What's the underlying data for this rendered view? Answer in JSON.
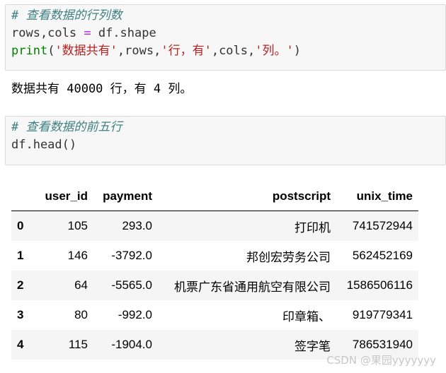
{
  "cell1": {
    "comment": "# 查看数据的行列数",
    "line2_vars": "rows,cols ",
    "line2_op": "=",
    "line2_rest": " df.shape",
    "line3_print": "print",
    "line3_open": "(",
    "line3_str1": "'数据共有'",
    "line3_mid1": ",rows,",
    "line3_str2": "'行，有'",
    "line3_mid2": ",cols,",
    "line3_str3": "'列。'",
    "line3_close": ")"
  },
  "output1": "数据共有 40000 行，有 4 列。",
  "cell2": {
    "comment": "# 查看数据的前五行",
    "code": "df.head()"
  },
  "table": {
    "columns": [
      "",
      "user_id",
      "payment",
      "postscript",
      "unix_time"
    ],
    "rows": [
      {
        "index": "0",
        "user_id": "105",
        "payment": "293.0",
        "postscript": "打印机",
        "unix_time": "741572944"
      },
      {
        "index": "1",
        "user_id": "146",
        "payment": "-3792.0",
        "postscript": "邦创宏劳务公司",
        "unix_time": "562452169"
      },
      {
        "index": "2",
        "user_id": "64",
        "payment": "-5565.0",
        "postscript": "机票广东省通用航空有限公司",
        "unix_time": "1586506116"
      },
      {
        "index": "3",
        "user_id": "80",
        "payment": "-992.0",
        "postscript": "印章箱、",
        "unix_time": "919779341"
      },
      {
        "index": "4",
        "user_id": "115",
        "payment": "-1904.0",
        "postscript": "签字笔",
        "unix_time": "786531940"
      }
    ]
  },
  "watermark": "CSDN @果园yyyyyyy"
}
